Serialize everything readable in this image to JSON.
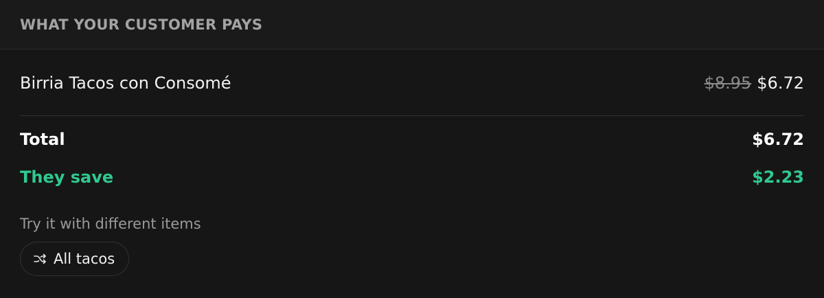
{
  "header": {
    "title": "WHAT YOUR CUSTOMER PAYS"
  },
  "item": {
    "name": "Birria Tacos con Consomé",
    "original_price": "$8.95",
    "discounted_price": "$6.72"
  },
  "summary": {
    "total_label": "Total",
    "total_value": "$6.72",
    "save_label": "They save",
    "save_value": "$2.23"
  },
  "try_section": {
    "hint": "Try it with different items",
    "chip_label": "All tacos",
    "chip_icon": "shuffle-icon"
  },
  "colors": {
    "background": "#161616",
    "accent_green": "#2fc98f",
    "muted_text": "#9a9a9a"
  }
}
